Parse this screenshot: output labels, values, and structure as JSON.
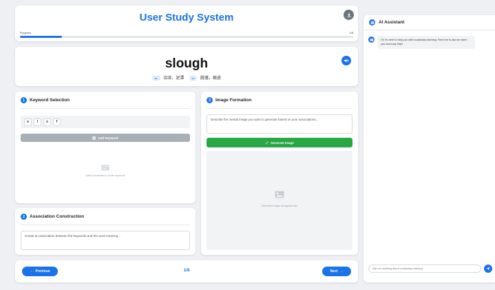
{
  "header": {
    "title": "User Study System",
    "progress_label": "Progress",
    "progress_count": "1/8",
    "progress_fraction": 0.125
  },
  "word": {
    "text": "slough",
    "definitions": [
      {
        "pos": "n.",
        "meaning": "沼泽，泥潭"
      },
      {
        "pos": "v.",
        "meaning": "脱落，蜕皮"
      }
    ]
  },
  "keyword_panel": {
    "step": "1",
    "title": "Keyword Selection",
    "letters": [
      "s",
      "l",
      "ʌ",
      "f"
    ],
    "add_label": "Add Keyword",
    "empty_text": "Select phonemes to create keywords"
  },
  "association_panel": {
    "step": "2",
    "title": "Association Construction",
    "placeholder": "Create an association between the keywords and the word meaning..."
  },
  "image_panel": {
    "step": "3",
    "title": "Image Formation",
    "placeholder": "Describe the mental image you want to generate based on your associations...",
    "generate_label": "Generate Image",
    "empty_text": "Generated image will appear here"
  },
  "nav": {
    "prev_label": "Previous",
    "next_label": "Next",
    "count": "1/8"
  },
  "assistant": {
    "title": "AI Assistant",
    "message": "Hi! I'm here to help you with vocabulary learning. Feel free to ask me when you need any help!",
    "input_placeholder": "Ask me anything about vocabulary learning..."
  },
  "colors": {
    "accent": "#1a73e8",
    "success": "#28a745",
    "disabled": "#a9afb6"
  }
}
